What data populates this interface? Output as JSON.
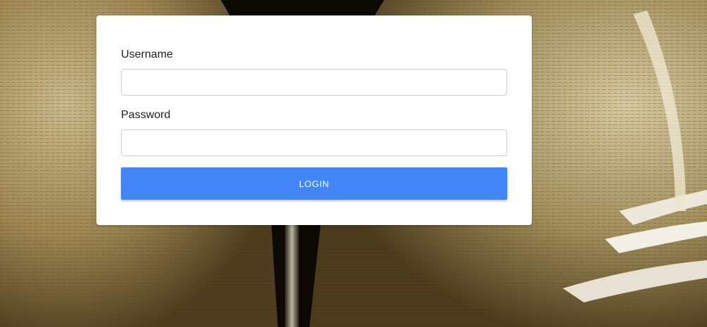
{
  "login_form": {
    "username_label": "Username",
    "username_value": "",
    "password_label": "Password",
    "password_value": "",
    "login_button_label": "LOGIN"
  },
  "theme": {
    "button_color": "#4285f4",
    "card_background": "#ffffff"
  },
  "background": {
    "subject": "heart-shaped-book-pages-photo"
  }
}
